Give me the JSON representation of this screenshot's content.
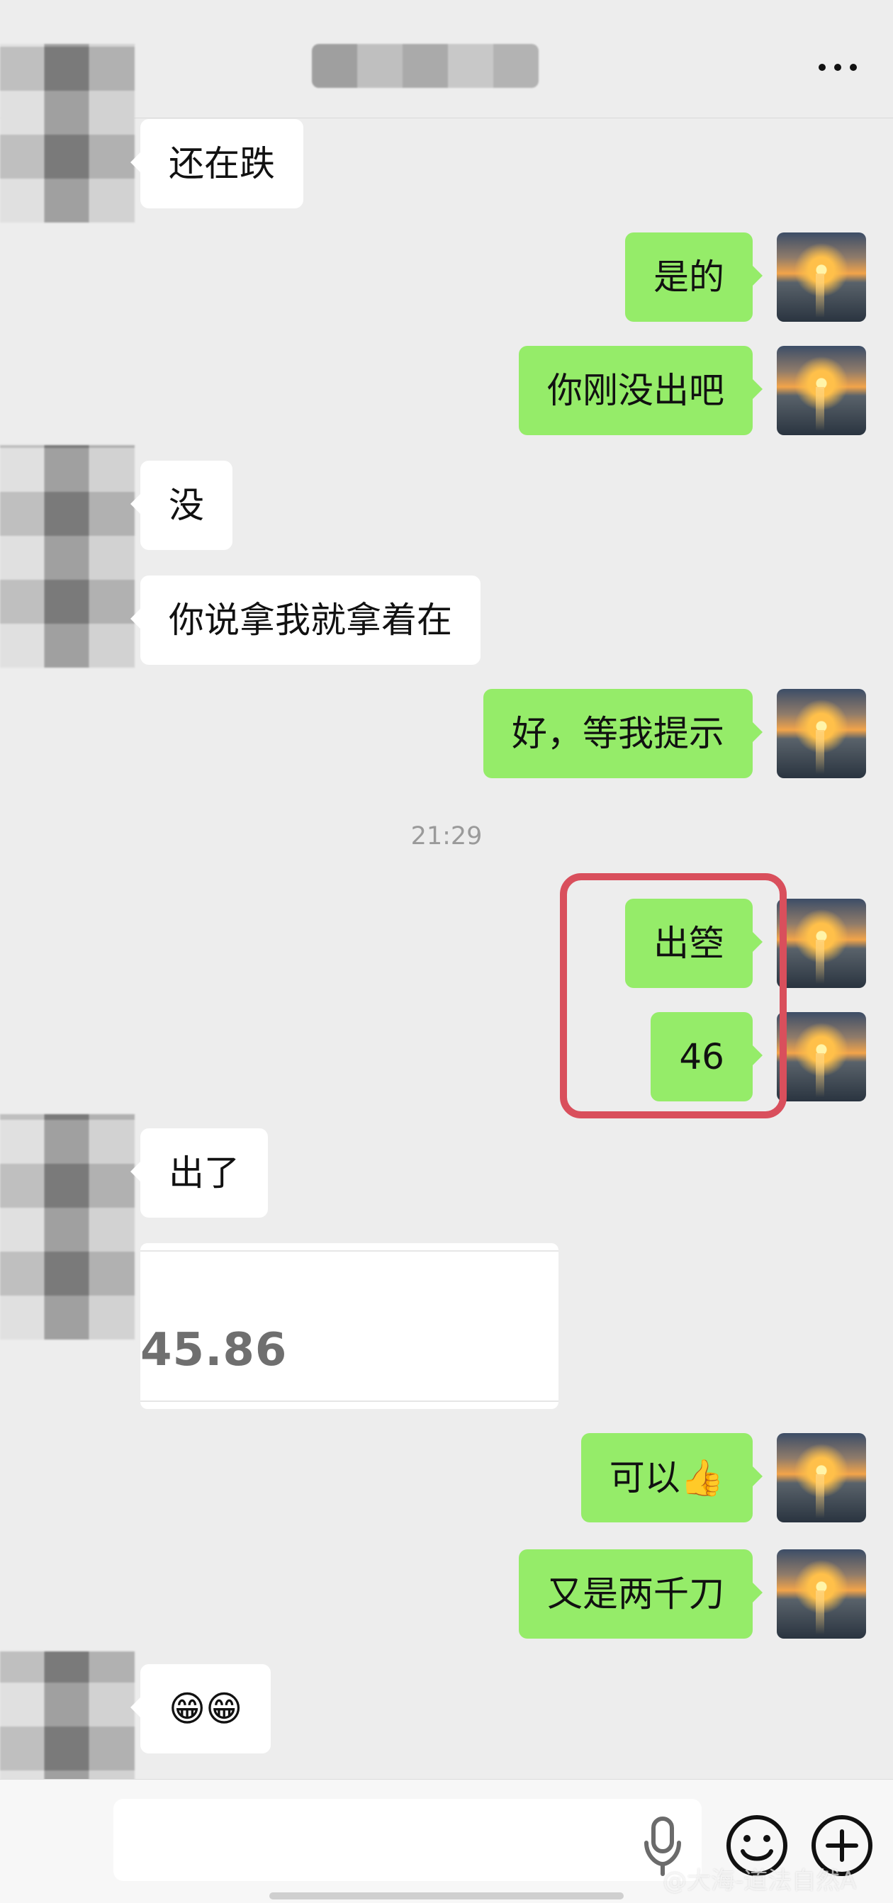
{
  "header": {
    "more_icon": "more-icon"
  },
  "messages": [
    {
      "side": "in",
      "text": "还在跌"
    },
    {
      "side": "out",
      "text": "是的"
    },
    {
      "side": "out",
      "text": "你刚没出吧"
    },
    {
      "side": "in",
      "text": "没"
    },
    {
      "side": "in",
      "text": "你说拿我就拿着在"
    },
    {
      "side": "out",
      "text": "好，等我提示"
    },
    {
      "side": "out",
      "text": "出箜"
    },
    {
      "side": "out",
      "text": "46"
    },
    {
      "side": "in",
      "text": "出了"
    },
    {
      "side": "out",
      "text": "可以👍"
    },
    {
      "side": "out",
      "text": "又是两千刀"
    },
    {
      "side": "in",
      "text": "😁😁"
    }
  ],
  "timestamp": "21:29",
  "image_card": {
    "value": "45.86"
  },
  "input_bar": {
    "placeholder": "",
    "voice_icon": "microphone-icon",
    "emoji_icon": "emoji-icon",
    "add_icon": "add-icon"
  },
  "watermark": "@大海-道法自然A",
  "colors": {
    "background": "#ededed",
    "incoming_bubble": "#ffffff",
    "outgoing_bubble": "#95ec69",
    "highlight": "#d94f5c",
    "timestamp": "#9a9a9a"
  }
}
